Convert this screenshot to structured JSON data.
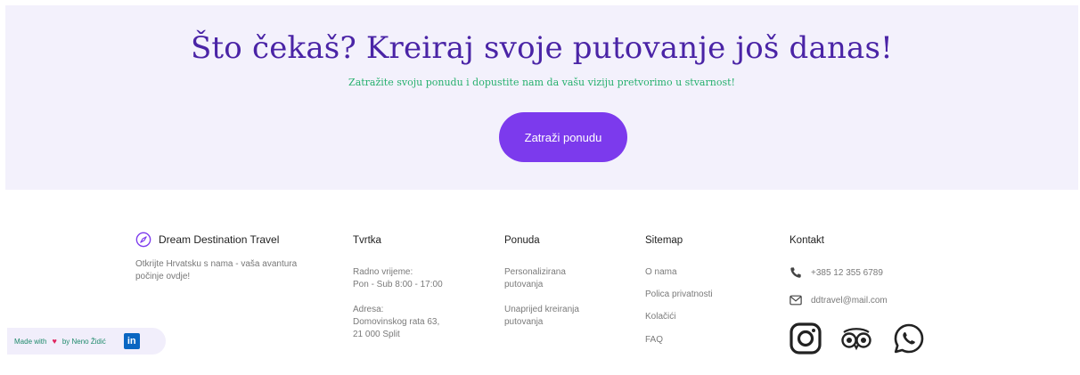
{
  "cta": {
    "title": "Što čekaš? Kreiraj svoje putovanje još danas!",
    "subtitle": "Zatražite svoju ponudu i dopustite nam da vašu viziju pretvorimo u stvarnost!",
    "button_label": "Zatraži ponudu"
  },
  "brand": {
    "name": "Dream Destination Travel",
    "tagline": "Otkrijte Hrvatsku s nama - vaša avantura počinje ovdje!",
    "icon": "compass-icon"
  },
  "company": {
    "heading": "Tvrtka",
    "hours_label": "Radno vrijeme:",
    "hours_value": "Pon - Sub 8:00 - 17:00",
    "address_label": "Adresa:",
    "address_line1": "Domovinskog rata 63,",
    "address_line2": "21 000 Split"
  },
  "offer": {
    "heading": "Ponuda",
    "items": [
      "Personalizirana putovanja",
      "Unaprijed kreiranja putovanja"
    ]
  },
  "sitemap": {
    "heading": "Sitemap",
    "items": [
      "O nama",
      "Polica privatnosti",
      "Kolačići",
      "FAQ"
    ]
  },
  "contact": {
    "heading": "Kontakt",
    "phone": "+385 12 355 6789",
    "email": "ddtravel@mail.com",
    "social": [
      "instagram-icon",
      "tripadvisor-icon",
      "whatsapp-icon"
    ]
  },
  "credit": {
    "prefix": "Made with",
    "suffix": "by Neno Židić",
    "linkedin": "in"
  },
  "colors": {
    "accent": "#7c3aed",
    "title": "#4a24a6",
    "subtitle": "#27b06e",
    "cta_bg": "#f3f1fc"
  }
}
